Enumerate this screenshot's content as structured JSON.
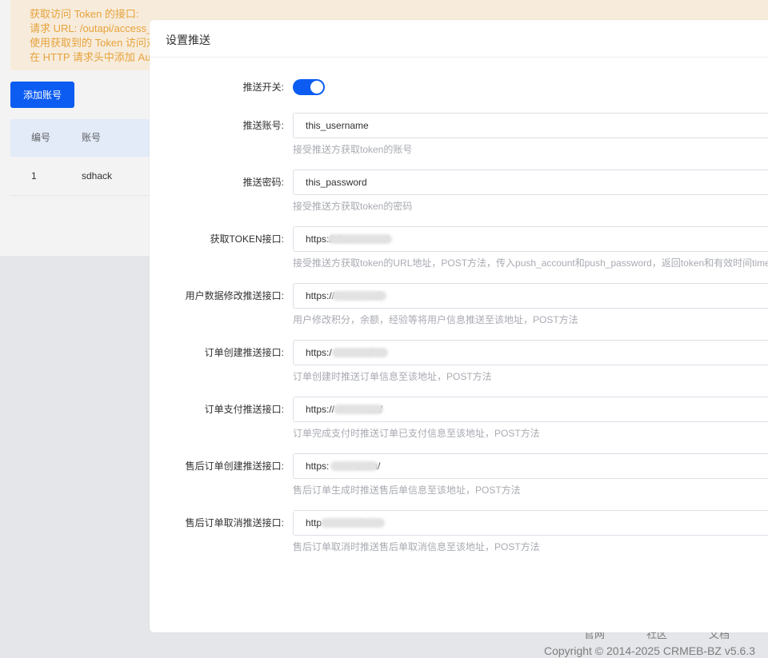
{
  "notice": {
    "lines": [
      "获取访问 Token 的接口:",
      "请求 URL: /outapi/access_",
      "使用获取到的 Token 访问对",
      "在 HTTP 请求头中添加 Au"
    ]
  },
  "add_account_label": "添加账号",
  "table": {
    "headers": [
      "编号",
      "账号"
    ],
    "rows": [
      [
        "1",
        "sdhack"
      ]
    ]
  },
  "footer": {
    "links": [
      "官网",
      "社区",
      "文档"
    ],
    "copyright": "Copyright © 2014-2025 CRMEB-BZ v5.6.3"
  },
  "modal": {
    "title": "设置推送",
    "switch": {
      "label": "推送开关:",
      "on": true
    },
    "fields": [
      {
        "label": "推送账号:",
        "value": "this_username",
        "tip": "接受推送方获取token的账号"
      },
      {
        "label": "推送密码:",
        "value": "this_password",
        "tip": "接受推送方获取token的密码"
      },
      {
        "label": "获取TOKEN接口:",
        "value": "https://shanma.ren/",
        "tip": "接受推送方获取token的URL地址，POST方法，传入push_account和push_password，返回token和有效时间time"
      },
      {
        "label": "用户数据修改推送接口:",
        "value": "https://            en/",
        "tip": "用户修改积分，余额，经验等将用户信息推送至该地址，POST方法"
      },
      {
        "label": "订单创建推送接口:",
        "value": "https:/            n/",
        "tip": "订单创建时推送订单信息至该地址，POST方法"
      },
      {
        "label": "订单支付推送接口:",
        "value": "https://            .en/",
        "tip": "订单完成支付时推送订单已支付信息至该地址，POST方法"
      },
      {
        "label": "售后订单创建推送接口:",
        "value": "https:          a.ren/",
        "tip": "售后订单生成时推送售后单信息至该地址，POST方法"
      },
      {
        "label": "售后订单取消推送接口:",
        "value": "http              /",
        "tip": "售后订单取消时推送售后单取消信息至该地址，POST方法"
      }
    ]
  }
}
